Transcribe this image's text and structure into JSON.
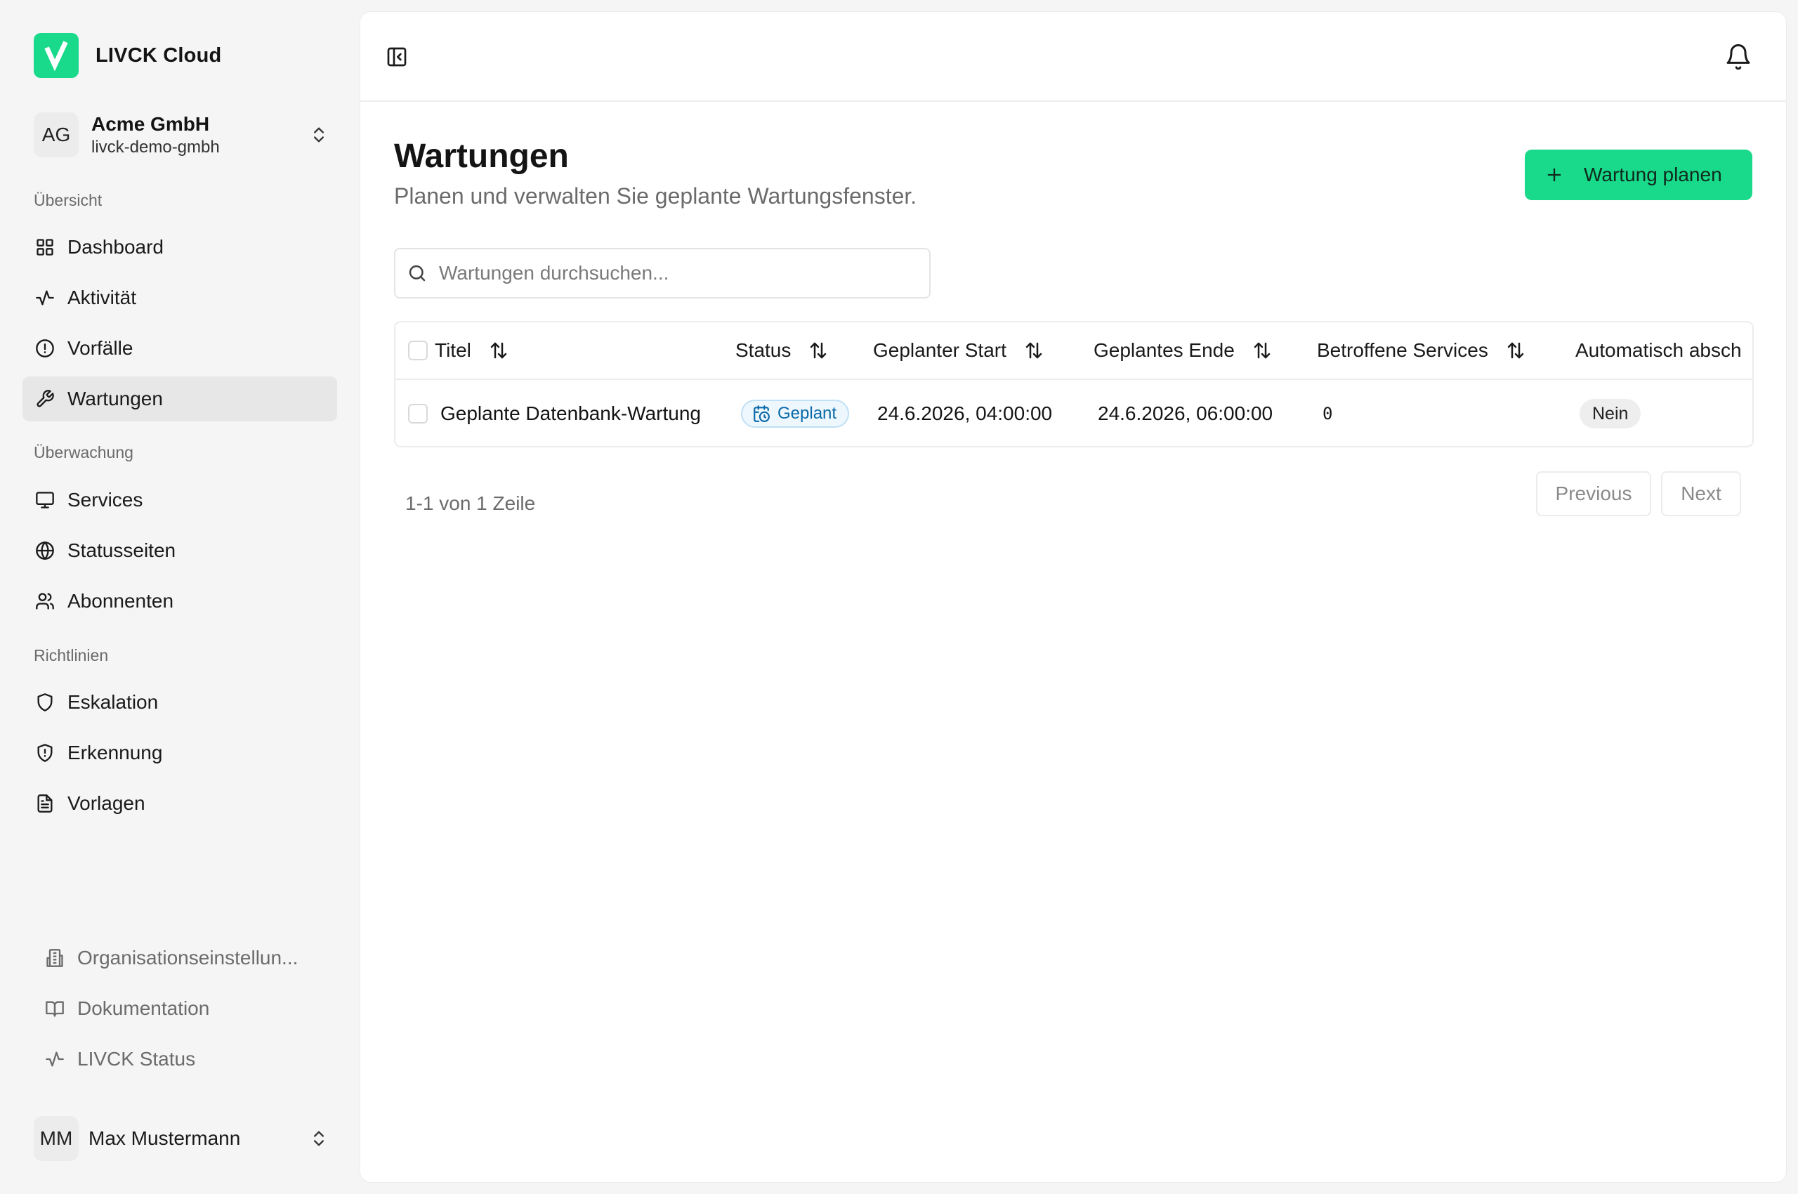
{
  "brand": {
    "name": "LIVCK Cloud",
    "color": "#19d98b"
  },
  "org": {
    "initials": "AG",
    "name": "Acme GmbH",
    "slug": "livck-demo-gmbh"
  },
  "sections": {
    "overview": "Übersicht",
    "monitoring": "Überwachung",
    "policies": "Richtlinien"
  },
  "nav": {
    "dashboard": "Dashboard",
    "activity": "Aktivität",
    "incidents": "Vorfälle",
    "maintenance": "Wartungen",
    "services": "Services",
    "statuspages": "Statusseiten",
    "subscribers": "Abonnenten",
    "escalation": "Eskalation",
    "detection": "Erkennung",
    "templates": "Vorlagen"
  },
  "footer": {
    "org_settings": "Organisationseinstellun...",
    "docs": "Dokumentation",
    "status": "LIVCK Status"
  },
  "user": {
    "initials": "MM",
    "name": "Max Mustermann"
  },
  "page": {
    "title": "Wartungen",
    "subtitle": "Planen und verwalten Sie geplante Wartungsfenster.",
    "primary_button": "Wartung planen"
  },
  "search": {
    "placeholder": "Wartungen durchsuchen..."
  },
  "table": {
    "columns": {
      "title": "Titel",
      "status": "Status",
      "start": "Geplanter Start",
      "end": "Geplantes Ende",
      "services": "Betroffene Services",
      "auto": "Automatisch absch"
    },
    "rows": [
      {
        "title": "Geplante Datenbank-Wartung",
        "status": "Geplant",
        "start": "24.6.2026, 04:00:00",
        "end": "24.6.2026, 06:00:00",
        "services": "0",
        "auto": "Nein"
      }
    ]
  },
  "pagination": {
    "summary": "1-1 von 1 Zeile",
    "previous": "Previous",
    "next": "Next"
  },
  "icons": {
    "brand": "check-logo-icon",
    "org_chevron": "chevrons-up-down-icon",
    "dashboard": "layout-grid-icon",
    "activity": "activity-pulse-icon",
    "incidents": "alert-circle-icon",
    "maintenance": "wrench-icon",
    "services": "monitor-icon",
    "statuspages": "globe-icon",
    "subscribers": "users-icon",
    "escalation": "shield-icon",
    "detection": "shield-alert-icon",
    "templates": "file-text-icon",
    "org_settings": "building-icon",
    "docs": "book-open-icon",
    "status": "activity-pulse-icon",
    "sidebar_toggle": "panel-left-close-icon",
    "notifications": "bell-icon",
    "add": "plus-icon",
    "search": "search-icon",
    "sort": "arrow-up-down-icon",
    "scheduled": "calendar-clock-icon"
  }
}
